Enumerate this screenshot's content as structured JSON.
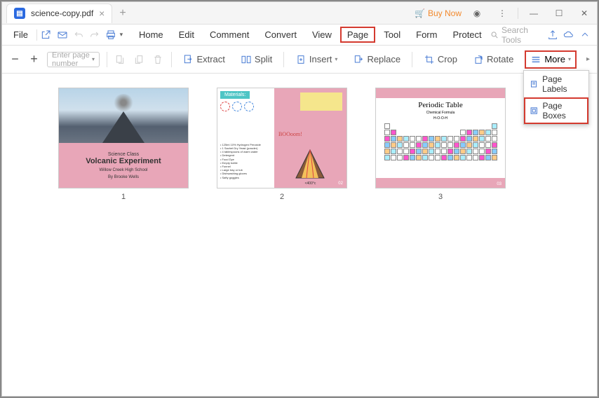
{
  "tab": {
    "title": "science-copy.pdf"
  },
  "titlebar": {
    "buynow": "Buy Now"
  },
  "menu": {
    "file": "File",
    "items": [
      "Home",
      "Edit",
      "Comment",
      "Convert",
      "View",
      "Page",
      "Tool",
      "Form",
      "Protect"
    ],
    "active_index": 5,
    "search": "Search Tools"
  },
  "toolbar": {
    "page_placeholder": "Enter page number",
    "extract": "Extract",
    "split": "Split",
    "insert": "Insert",
    "replace": "Replace",
    "crop": "Crop",
    "rotate": "Rotate",
    "more": "More"
  },
  "dropdown": {
    "page_labels": "Page Labels",
    "page_boxes": "Page Boxes"
  },
  "pages": {
    "count": 3,
    "labels": [
      "1",
      "2",
      "3"
    ]
  },
  "slide1": {
    "subtitle": "Science Class",
    "title": "Volcanic Experiment",
    "school": "Willow Creek High School",
    "author": "By Brooke Wells"
  },
  "slide2": {
    "materials_label": "Materials:",
    "boom": "BOOoom!",
    "list": "• 125ml 10% Hydrogen Peroxide\n• 1 Sachet Dry Yeast (powder)\n• 4 tablespoons of warm water\n• Detergent\n• Food Dye\n• Empty bottle\n• Funnel\n• Large tray or tub\n• Dishwashing gloves\n• Safty goggles",
    "temp": "<400°c",
    "page": "02"
  },
  "slide3": {
    "title": "Periodic Table",
    "subtitle": "Chemical Formula",
    "formula": "H-O-O-H",
    "page": "03"
  }
}
